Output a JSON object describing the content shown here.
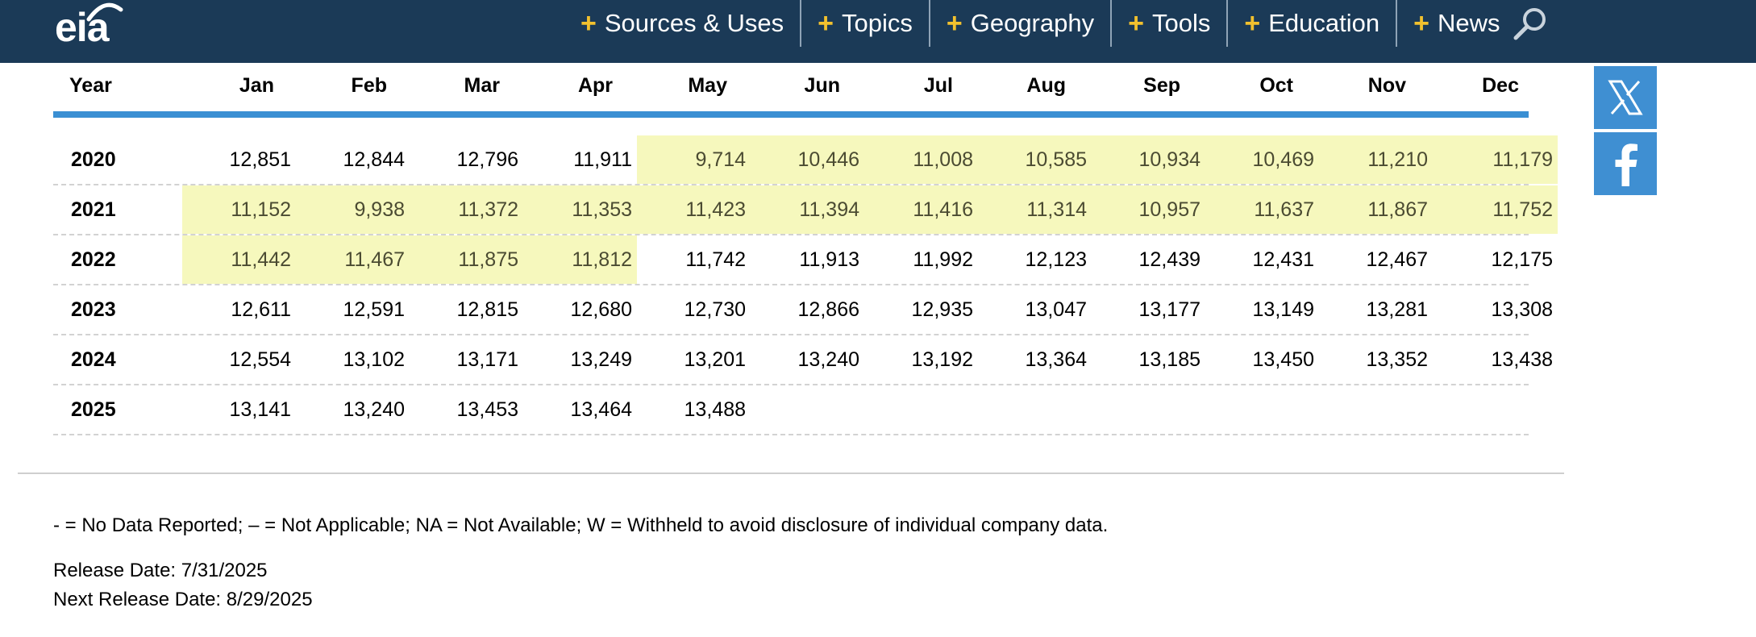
{
  "header": {
    "logo_text": "eia",
    "nav": [
      {
        "label": "Sources & Uses"
      },
      {
        "label": "Topics"
      },
      {
        "label": "Geography"
      },
      {
        "label": "Tools"
      },
      {
        "label": "Education"
      },
      {
        "label": "News"
      }
    ],
    "icons": {
      "search": "search-icon",
      "x": "x-logo-icon",
      "facebook": "facebook-icon"
    },
    "colors": {
      "bar": "#1b3a57",
      "accent": "#f2c12e",
      "social": "#3f8fd2",
      "highlight": "#f6f8bd",
      "header_rule": "#3a8fd3"
    }
  },
  "table": {
    "columns": [
      "Year",
      "Jan",
      "Feb",
      "Mar",
      "Apr",
      "May",
      "Jun",
      "Jul",
      "Aug",
      "Sep",
      "Oct",
      "Nov",
      "Dec"
    ],
    "rows": [
      {
        "year": "2020",
        "values": [
          "12,851",
          "12,844",
          "12,796",
          "11,911",
          "9,714",
          "10,446",
          "11,008",
          "10,585",
          "10,934",
          "10,469",
          "11,210",
          "11,179"
        ]
      },
      {
        "year": "2021",
        "values": [
          "11,152",
          "9,938",
          "11,372",
          "11,353",
          "11,423",
          "11,394",
          "11,416",
          "11,314",
          "10,957",
          "11,637",
          "11,867",
          "11,752"
        ]
      },
      {
        "year": "2022",
        "values": [
          "11,442",
          "11,467",
          "11,875",
          "11,812",
          "11,742",
          "11,913",
          "11,992",
          "12,123",
          "12,439",
          "12,431",
          "12,467",
          "12,175"
        ]
      },
      {
        "year": "2023",
        "values": [
          "12,611",
          "12,591",
          "12,815",
          "12,680",
          "12,730",
          "12,866",
          "12,935",
          "13,047",
          "13,177",
          "13,149",
          "13,281",
          "13,308"
        ]
      },
      {
        "year": "2024",
        "values": [
          "12,554",
          "13,102",
          "13,171",
          "13,249",
          "13,201",
          "13,240",
          "13,192",
          "13,364",
          "13,185",
          "13,450",
          "13,352",
          "13,438"
        ]
      },
      {
        "year": "2025",
        "values": [
          "13,141",
          "13,240",
          "13,453",
          "13,464",
          "13,488",
          "",
          "",
          "",
          "",
          "",
          "",
          ""
        ]
      }
    ]
  },
  "footer": {
    "legend": "- = No Data Reported;  – = Not Applicable;  NA = Not Available;  W = Withheld to avoid disclosure of individual company data.",
    "release_date": "Release Date: 7/31/2025",
    "next_release_date": "Next Release Date: 8/29/2025"
  }
}
